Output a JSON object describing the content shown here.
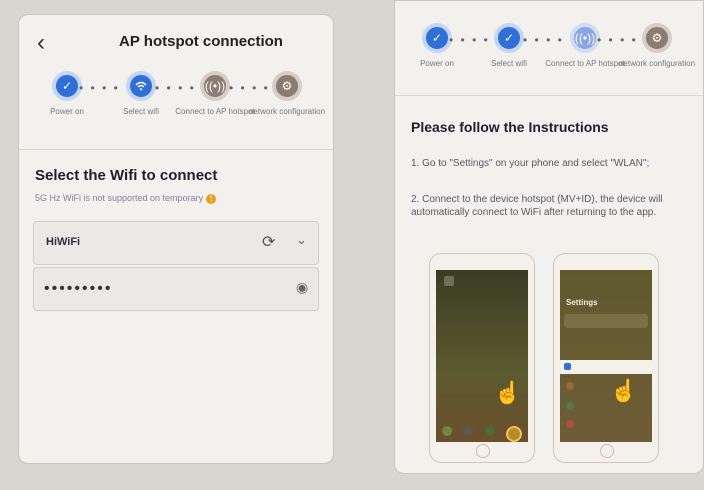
{
  "left": {
    "title": "AP hotspot connection",
    "steps": [
      "Power on",
      "Select wifi",
      "Connect to AP hotspot",
      "network configuration"
    ],
    "heading": "Select the Wifi to connect",
    "note": "5G Hz WiFi is not supported on temporary",
    "ssid": "HiWiFi",
    "password": "•••••••••"
  },
  "right": {
    "steps": [
      "Power on",
      "Select wifi",
      "Connect to AP hotspot",
      "network configuration"
    ],
    "heading": "Please follow the Instructions",
    "instr1": "1. Go to \"Settings\" on your phone and select \"WLAN\";",
    "instr2": "2. Connect to the device hotspot (MV+ID), the device will automatically connect to WiFi after returning to the app.",
    "settings_label": "Settings"
  },
  "icons": [
    "back-arrow-icon",
    "check-icon",
    "wifi-icon",
    "hotspot-icon",
    "gear-icon",
    "refresh-icon",
    "chevron-down-icon",
    "eye-icon",
    "warning-icon",
    "hand-icon"
  ],
  "colors": {
    "accent": "#2f6fd6",
    "warn": "#e8a020"
  }
}
